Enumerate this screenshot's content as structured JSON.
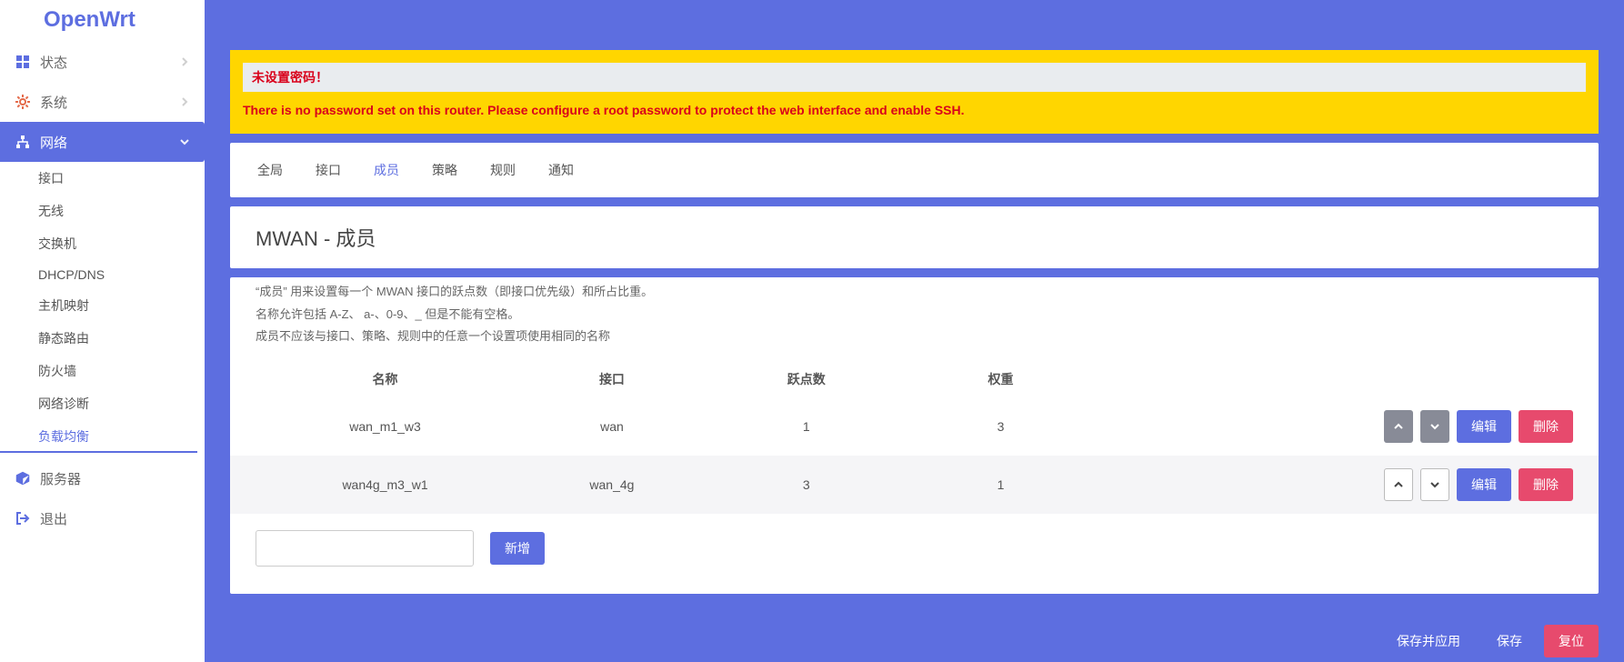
{
  "brand": "OpenWrt",
  "sidebar": {
    "top": [
      {
        "icon": "grid",
        "label": "状态"
      },
      {
        "icon": "gear",
        "label": "系统"
      },
      {
        "icon": "sitemap",
        "label": "网络",
        "active": true
      }
    ],
    "sub": [
      "接口",
      "无线",
      "交换机",
      "DHCP/DNS",
      "主机映射",
      "静态路由",
      "防火墙",
      "网络诊断",
      "负载均衡"
    ],
    "sub_active_index": 8,
    "bottom": [
      {
        "icon": "cube",
        "label": "服务器"
      },
      {
        "icon": "exit",
        "label": "退出"
      }
    ]
  },
  "alert": {
    "title": "未设置密码！",
    "body": "There is no password set on this router. Please configure a root password to protect the web interface and enable SSH."
  },
  "tabs": {
    "items": [
      "全局",
      "接口",
      "成员",
      "策略",
      "规则",
      "通知"
    ],
    "active_index": 2
  },
  "page_title": "MWAN - 成员",
  "notes": {
    "l1": "“成员” 用来设置每一个 MWAN 接口的跃点数（即接口优先级）和所占比重。",
    "l2": "名称允许包括 A-Z、 a-、0-9、_  但是不能有空格。",
    "l3": "成员不应该与接口、策略、规则中的任意一个设置项使用相同的名称"
  },
  "table": {
    "headers": [
      "名称",
      "接口",
      "跃点数",
      "权重"
    ],
    "rows": [
      {
        "name": "wan_m1_w3",
        "iface": "wan",
        "metric": "1",
        "weight": "3",
        "move": "grey"
      },
      {
        "name": "wan4g_m3_w1",
        "iface": "wan_4g",
        "metric": "3",
        "weight": "1",
        "move": "white"
      }
    ],
    "edit": "编辑",
    "del": "删除"
  },
  "add": {
    "value": "",
    "button": "新增"
  },
  "footer": {
    "save_apply": "保存并应用",
    "save": "保存",
    "reset": "复位"
  }
}
